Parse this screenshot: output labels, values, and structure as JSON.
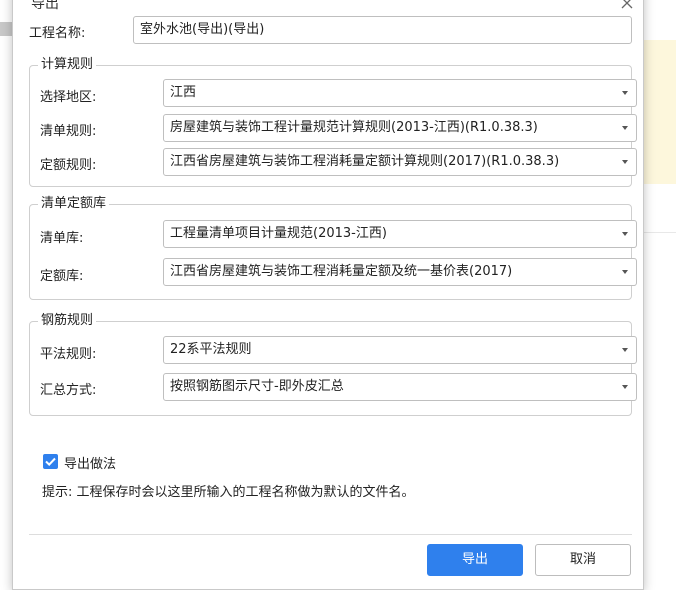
{
  "dialog": {
    "title": "导出",
    "project_name_label": "工程名称:",
    "project_name_value": "室外水池(导出)(导出)"
  },
  "groups": {
    "calc_rules": {
      "title": "计算规则",
      "rows": [
        {
          "label": "选择地区:",
          "value": "江西"
        },
        {
          "label": "清单规则:",
          "value": "房屋建筑与装饰工程计量规范计算规则(2013-江西)(R1.0.38.3)"
        },
        {
          "label": "定额规则:",
          "value": "江西省房屋建筑与装饰工程消耗量定额计算规则(2017)(R1.0.38.3)"
        }
      ]
    },
    "library": {
      "title": "清单定额库",
      "rows": [
        {
          "label": "清单库:",
          "value": "工程量清单项目计量规范(2013-江西)"
        },
        {
          "label": "定额库:",
          "value": "江西省房屋建筑与装饰工程消耗量定额及统一基价表(2017)"
        }
      ]
    },
    "rebar": {
      "title": "钢筋规则",
      "rows": [
        {
          "label": "平法规则:",
          "value": "22系平法规则"
        },
        {
          "label": "汇总方式:",
          "value": "按照钢筋图示尺寸-即外皮汇总"
        }
      ]
    }
  },
  "export_method": {
    "label": "导出做法",
    "checked": true
  },
  "hint": "提示: 工程保存时会以这里所输入的工程名称做为默认的文件名。",
  "buttons": {
    "export": "导出",
    "cancel": "取消"
  },
  "icons": {
    "close": "close-icon",
    "dropdown": "chevron-down-icon",
    "check": "check-icon"
  },
  "colors": {
    "accent": "#2f80ed",
    "bg_row_highlight": "#fdf7dc"
  }
}
